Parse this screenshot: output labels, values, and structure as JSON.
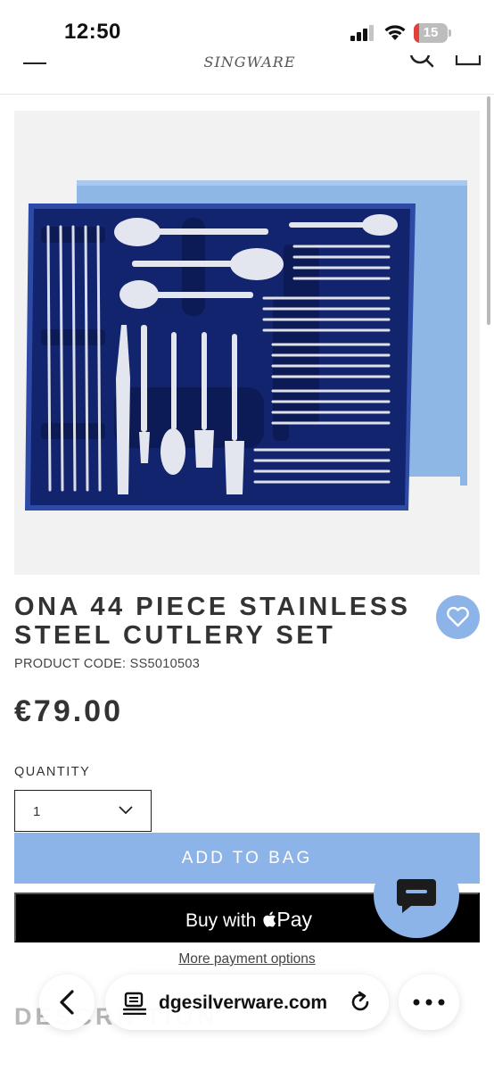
{
  "status_bar": {
    "time": "12:50",
    "battery_level": "15",
    "battery_fraction": 0.15,
    "battery_color": "#e0413a"
  },
  "header": {
    "logo_text": "SINGWARE",
    "menu_icon": "hamburger-menu-icon",
    "search_icon": "search-icon",
    "bag_icon": "shopping-bag-icon"
  },
  "product": {
    "image_alt": "cutlery set in blue presentation box",
    "title": "ONA 44 PIECE STAINLESS STEEL CUTLERY SET",
    "code_label": "PRODUCT CODE: SS5010503",
    "price": "€79.00",
    "quantity_label": "QUANTITY",
    "quantity_value": "1",
    "wishlist_icon": "heart-icon"
  },
  "actions": {
    "add_to_bag": "ADD TO BAG",
    "apple_pay_prefix": "Buy with",
    "apple_pay_word": "Pay",
    "more_payment": "More payment options"
  },
  "description": {
    "heading": "DESCRIPTION"
  },
  "chat": {
    "icon": "chat-bubble-icon"
  },
  "browser": {
    "url": "dgesilverware.com",
    "back_icon": "chevron-left-icon",
    "reader_icon": "reader-mode-icon",
    "reload_icon": "reload-icon",
    "more_icon": "more-dots-icon"
  },
  "colors": {
    "accent": "#8db4e8",
    "box_blue": "#13246e",
    "lid_blue": "#8fb7e6",
    "text": "#333333",
    "apple_pay_bg": "#000000"
  }
}
